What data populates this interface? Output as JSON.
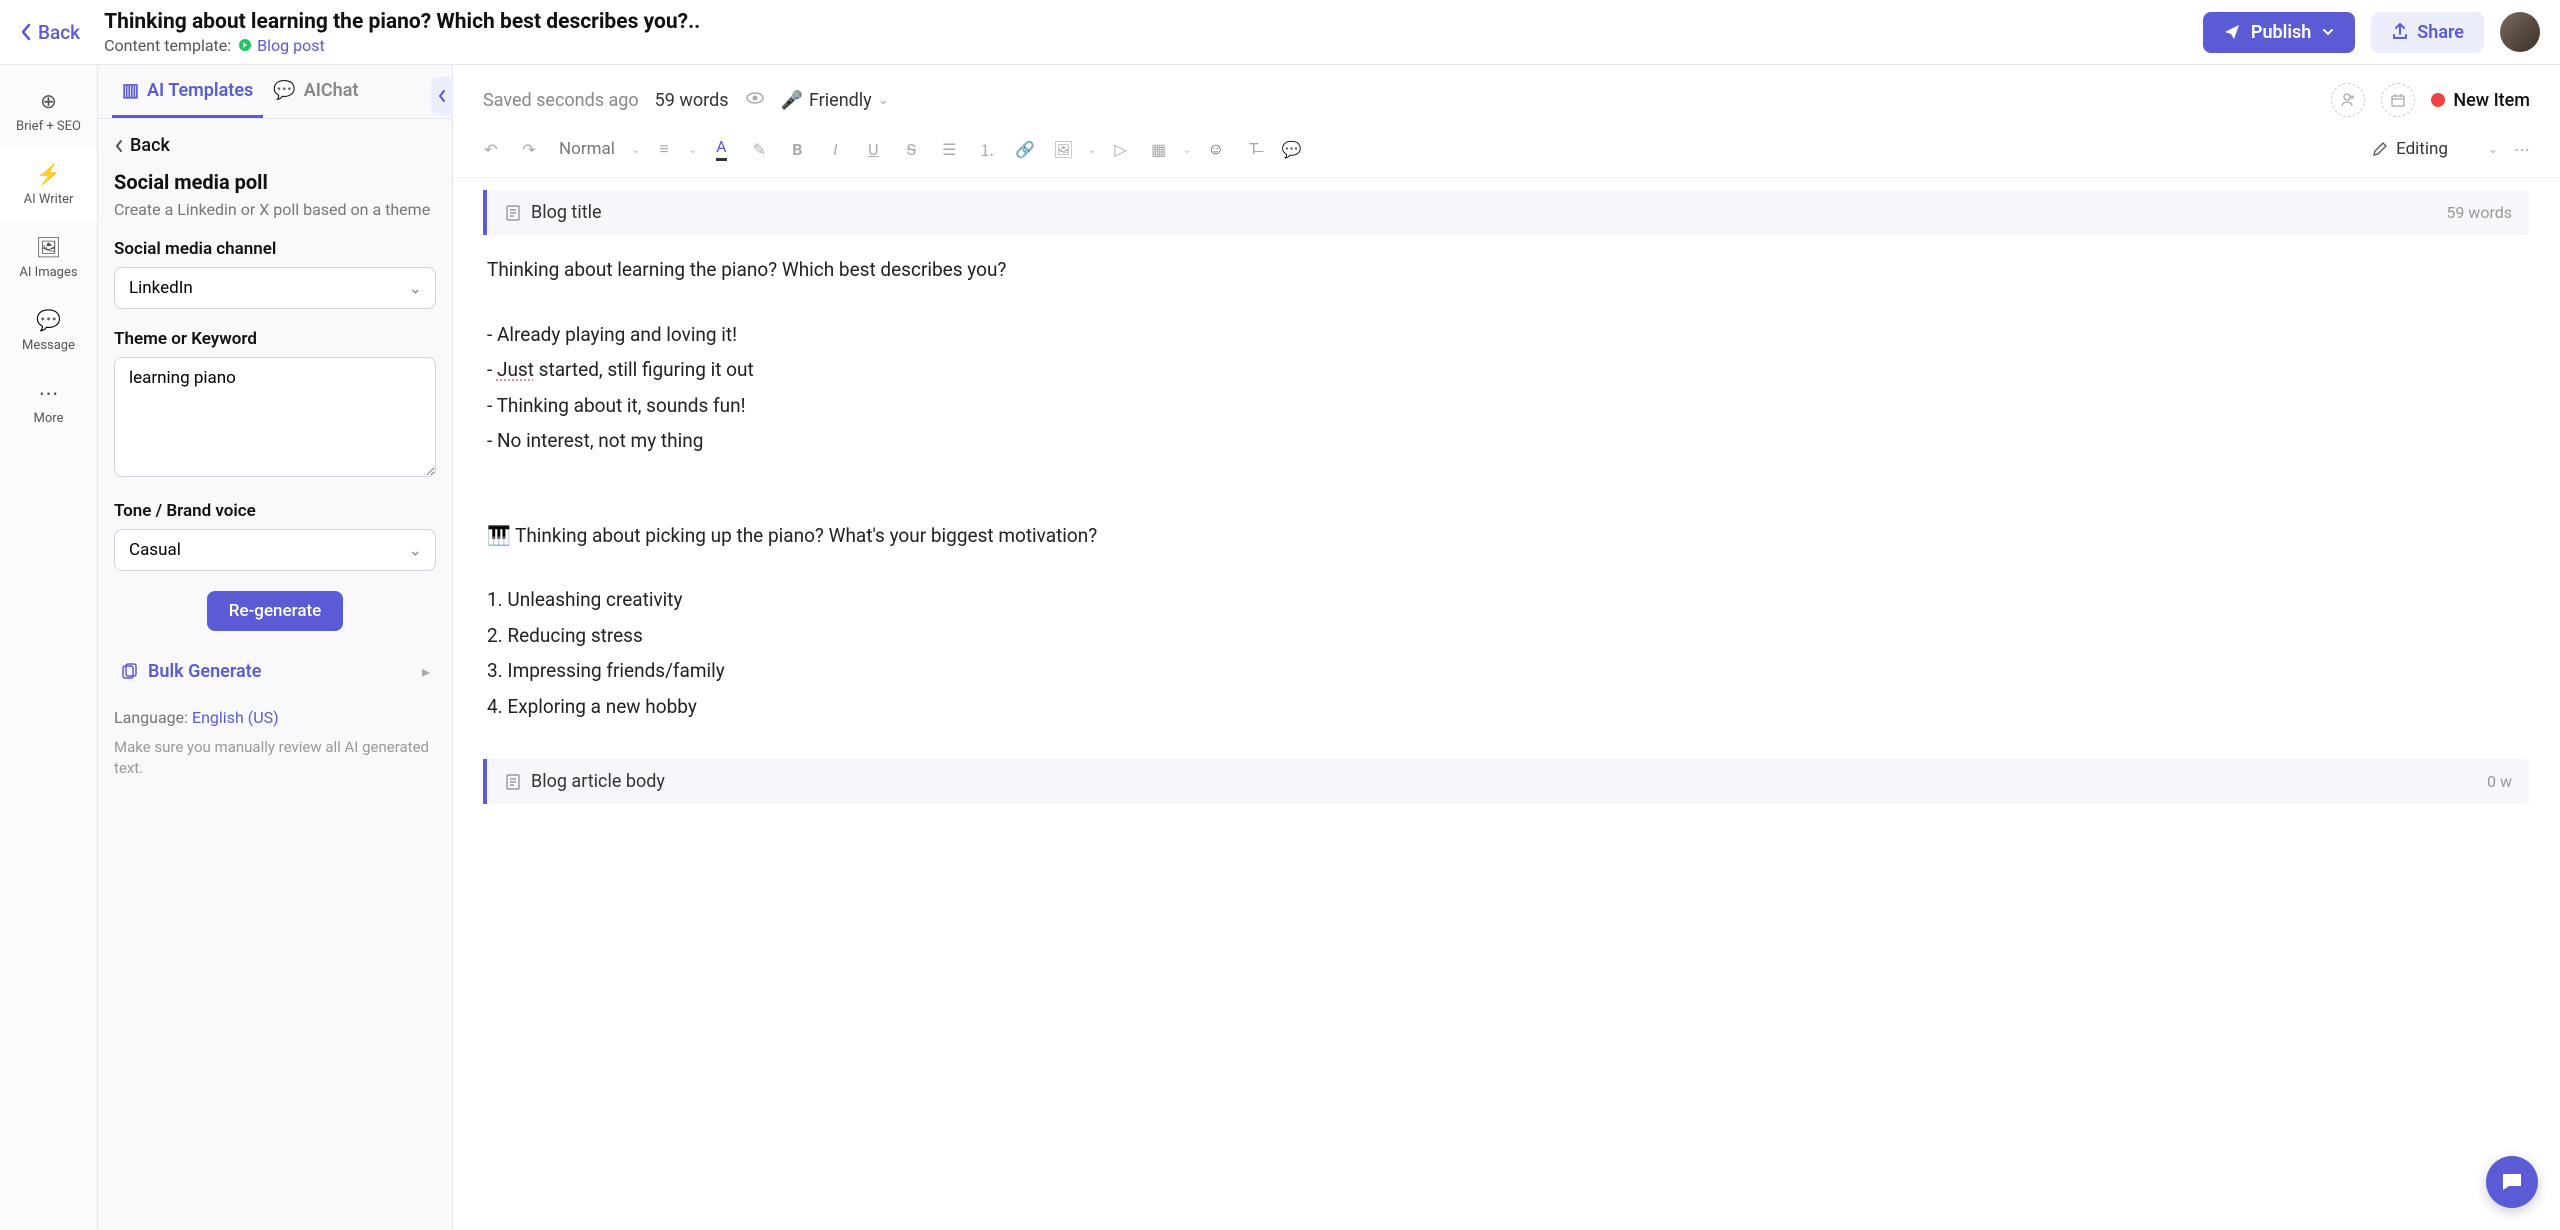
{
  "topbar": {
    "back": "Back",
    "title": "Thinking about learning the piano? Which best describes you?..",
    "subtitle_label": "Content template:",
    "subtitle_link": "Blog post",
    "publish": "Publish",
    "share": "Share"
  },
  "leftRail": [
    {
      "icon": "⊕",
      "label": "Brief + SEO"
    },
    {
      "icon": "⚡",
      "label": "AI Writer"
    },
    {
      "icon": "🖼",
      "label": "AI Images"
    },
    {
      "icon": "💬",
      "label": "Message"
    },
    {
      "icon": "⋯",
      "label": "More"
    }
  ],
  "sidebar": {
    "tabs": {
      "templates": "AI Templates",
      "chat": "AIChat"
    },
    "back": "Back",
    "heading": "Social media poll",
    "desc": "Create a Linkedin or X poll based on a theme",
    "channel_label": "Social media channel",
    "channel_value": "LinkedIn",
    "theme_label": "Theme or Keyword",
    "theme_value": "learning piano",
    "tone_label": "Tone / Brand voice",
    "tone_value": "Casual",
    "regen": "Re-generate",
    "bulk": "Bulk Generate",
    "lang_label": "Language: ",
    "lang_value": "English (US)",
    "review_note": "Make sure you manually review all AI generated text."
  },
  "editor": {
    "saved": "Saved seconds ago",
    "words": "59 words",
    "tone": "Friendly",
    "new_item": "New Item",
    "format_label": "Normal",
    "editing_mode": "Editing",
    "section1": {
      "title": "Blog title",
      "meta": "59 words"
    },
    "content": {
      "heading": "Thinking about learning the piano? Which best describes you?",
      "bullets": [
        "- Already playing and loving it!",
        "- Just started, still figuring it out",
        "- Thinking about it, sounds fun!",
        "- No interest, not my thing"
      ],
      "q2": "🎹 Thinking about picking up the piano? What's your biggest motivation?",
      "numbered": [
        "1. Unleashing creativity",
        "2. Reducing stress",
        "3. Impressing friends/family",
        "4. Exploring a new hobby"
      ]
    },
    "section2": {
      "title": "Blog article body",
      "meta": "0 w"
    }
  }
}
